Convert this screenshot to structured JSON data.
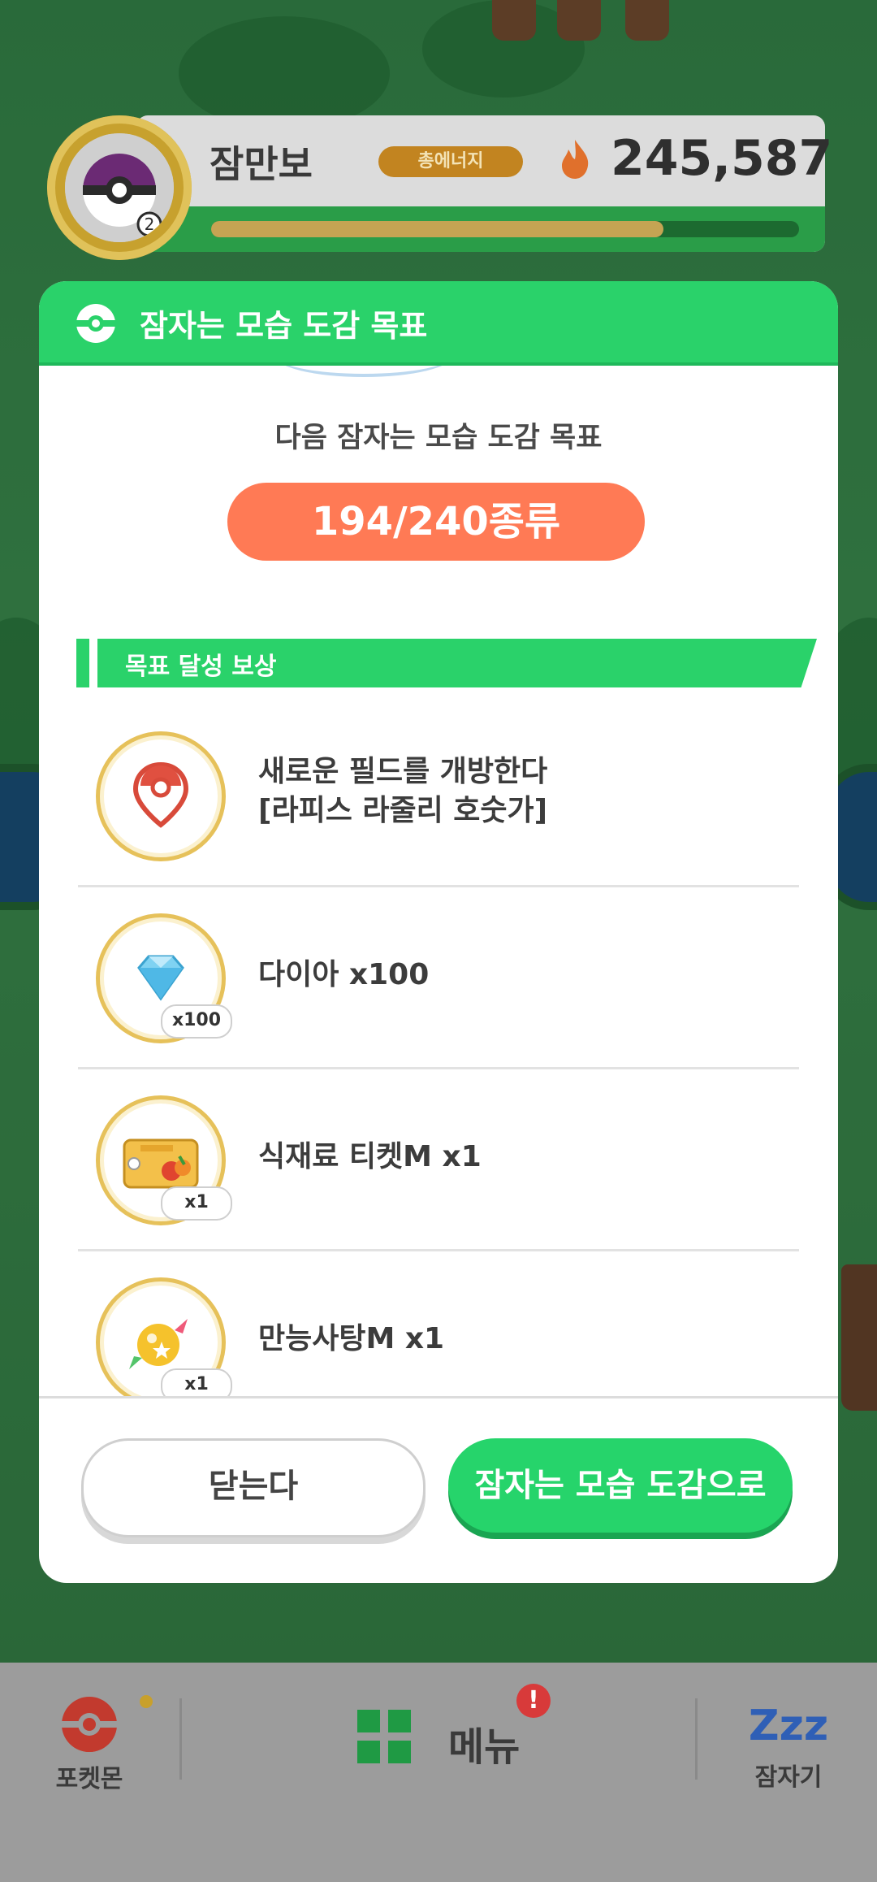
{
  "player": {
    "name": "잠만보",
    "badge_level": "2",
    "energy_label": "총에너지",
    "energy_value": "245,587",
    "progress_fraction": 0.77
  },
  "modal": {
    "title": "잠자는 모습 도감 목표",
    "goal_caption": "다음 잠자는 모습 도감 목표",
    "goal_progress": "194/240종류",
    "reward_section_title": "목표 달성 보상",
    "rewards": [
      {
        "icon": "map-pin-icon",
        "line1": "새로운 필드를 개방한다",
        "line2": "[라피스 라줄리 호숫가]",
        "qty": ""
      },
      {
        "icon": "diamond-icon",
        "line1": "다이아 x100",
        "line2": "",
        "qty": "x100"
      },
      {
        "icon": "ingredient-ticket-icon",
        "line1": "식재료 티켓M x1",
        "line2": "",
        "qty": "x1"
      },
      {
        "icon": "candy-icon",
        "line1": "만능사탕M x1",
        "line2": "",
        "qty": "x1"
      }
    ],
    "close_button": "닫는다",
    "go_button": "잠자는 모습 도감으로"
  },
  "nav": {
    "pokemon_label": "포켓몬",
    "menu_label": "메뉴",
    "menu_alert": "!",
    "sleep_label": "잠자기",
    "sleep_icon_text": "Zzz"
  },
  "colors": {
    "header_green": "#2ad26a",
    "goal_pill": "#ff7a55",
    "energy_pill": "#c28420"
  }
}
